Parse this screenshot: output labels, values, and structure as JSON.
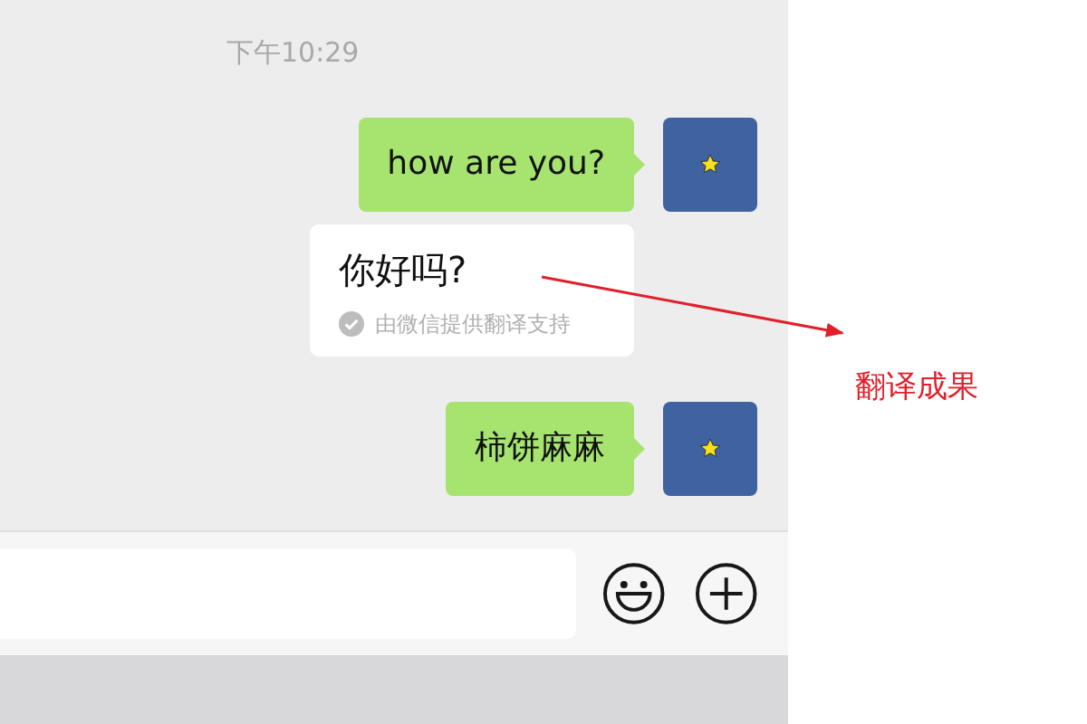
{
  "timestamp": "下午10:29",
  "messages": [
    {
      "kind": "sent",
      "text": "how are you?"
    },
    {
      "kind": "translation",
      "text": "你好吗?",
      "note": "由微信提供翻译支持"
    },
    {
      "kind": "sent",
      "text": "柿饼麻麻"
    }
  ],
  "annotation": {
    "label": "翻译成果"
  }
}
